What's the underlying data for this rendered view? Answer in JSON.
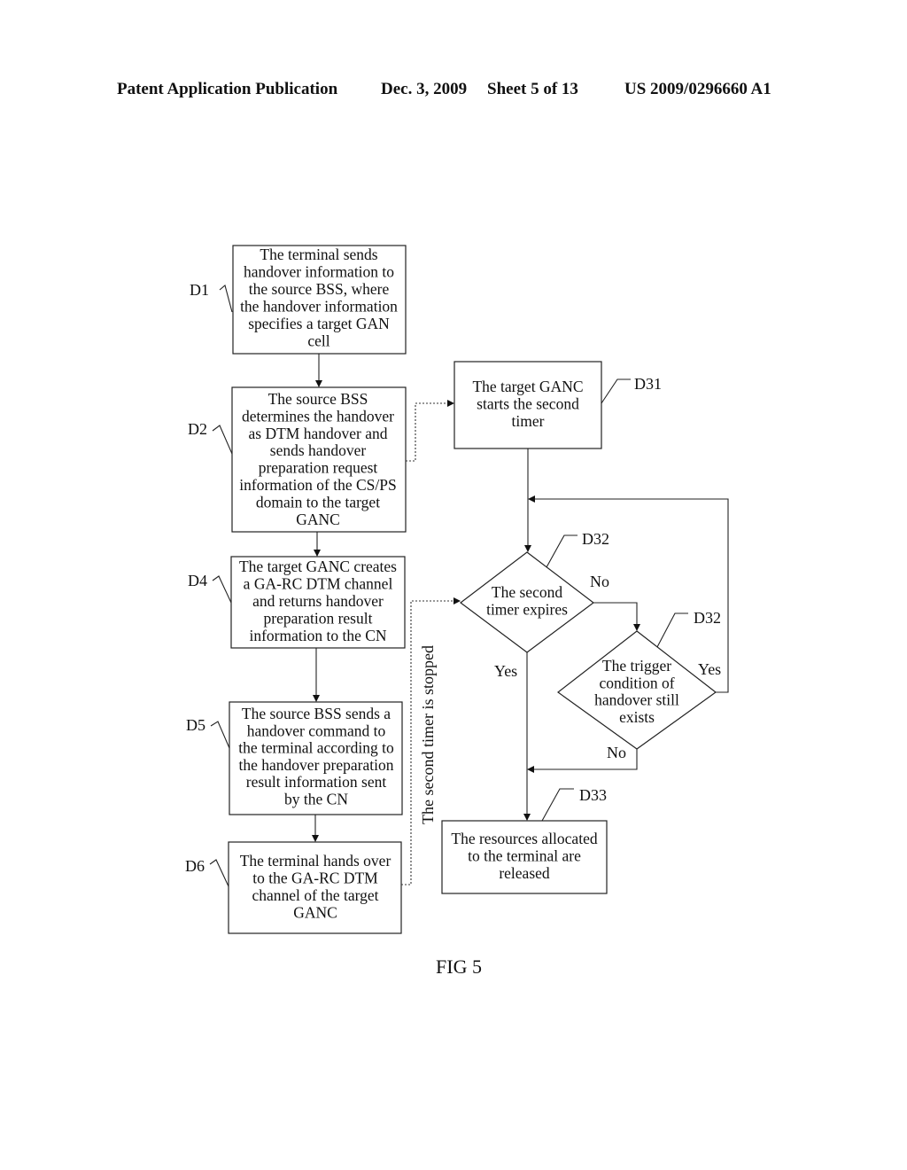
{
  "header": {
    "publication": "Patent Application Publication",
    "date": "Dec. 3, 2009",
    "sheet": "Sheet 5 of 13",
    "number": "US 2009/0296660 A1"
  },
  "figure_label": "FIG 5",
  "steps": {
    "D1": {
      "ref": "D1",
      "lines": [
        "The terminal sends",
        "handover information to",
        "the source BSS, where",
        "the handover information",
        "specifies a target GAN",
        "cell"
      ]
    },
    "D2": {
      "ref": "D2",
      "lines": [
        "The source BSS",
        "determines the handover",
        "as DTM handover and",
        "sends handover",
        "preparation request",
        "information of the CS/PS",
        "domain to the target",
        "GANC"
      ]
    },
    "D4": {
      "ref": "D4",
      "lines": [
        "The target GANC creates",
        "a GA-RC DTM channel",
        "and returns handover",
        "preparation result",
        "information to the CN"
      ]
    },
    "D5": {
      "ref": "D5",
      "lines": [
        "The source BSS sends a",
        "handover command to",
        "the terminal according to",
        "the handover preparation",
        "result information sent",
        "by the CN"
      ]
    },
    "D6": {
      "ref": "D6",
      "lines": [
        "The terminal hands over",
        "to the GA-RC DTM",
        "channel of the target",
        "GANC"
      ]
    },
    "D31": {
      "ref": "D31",
      "lines": [
        "The target GANC",
        "starts the second",
        "timer"
      ]
    },
    "D32a": {
      "ref": "D32",
      "lines": [
        "The second",
        "timer expires"
      ]
    },
    "D32b": {
      "ref": "D32",
      "lines": [
        "The trigger",
        "condition of",
        "handover still",
        "exists"
      ]
    },
    "D33": {
      "ref": "D33",
      "lines": [
        "The resources allocated",
        "to the terminal are",
        "released"
      ]
    }
  },
  "edge_labels": {
    "no1": "No",
    "yes1": "Yes",
    "yes2": "Yes",
    "no2": "No",
    "timer_stopped": "The second timer is stopped"
  }
}
